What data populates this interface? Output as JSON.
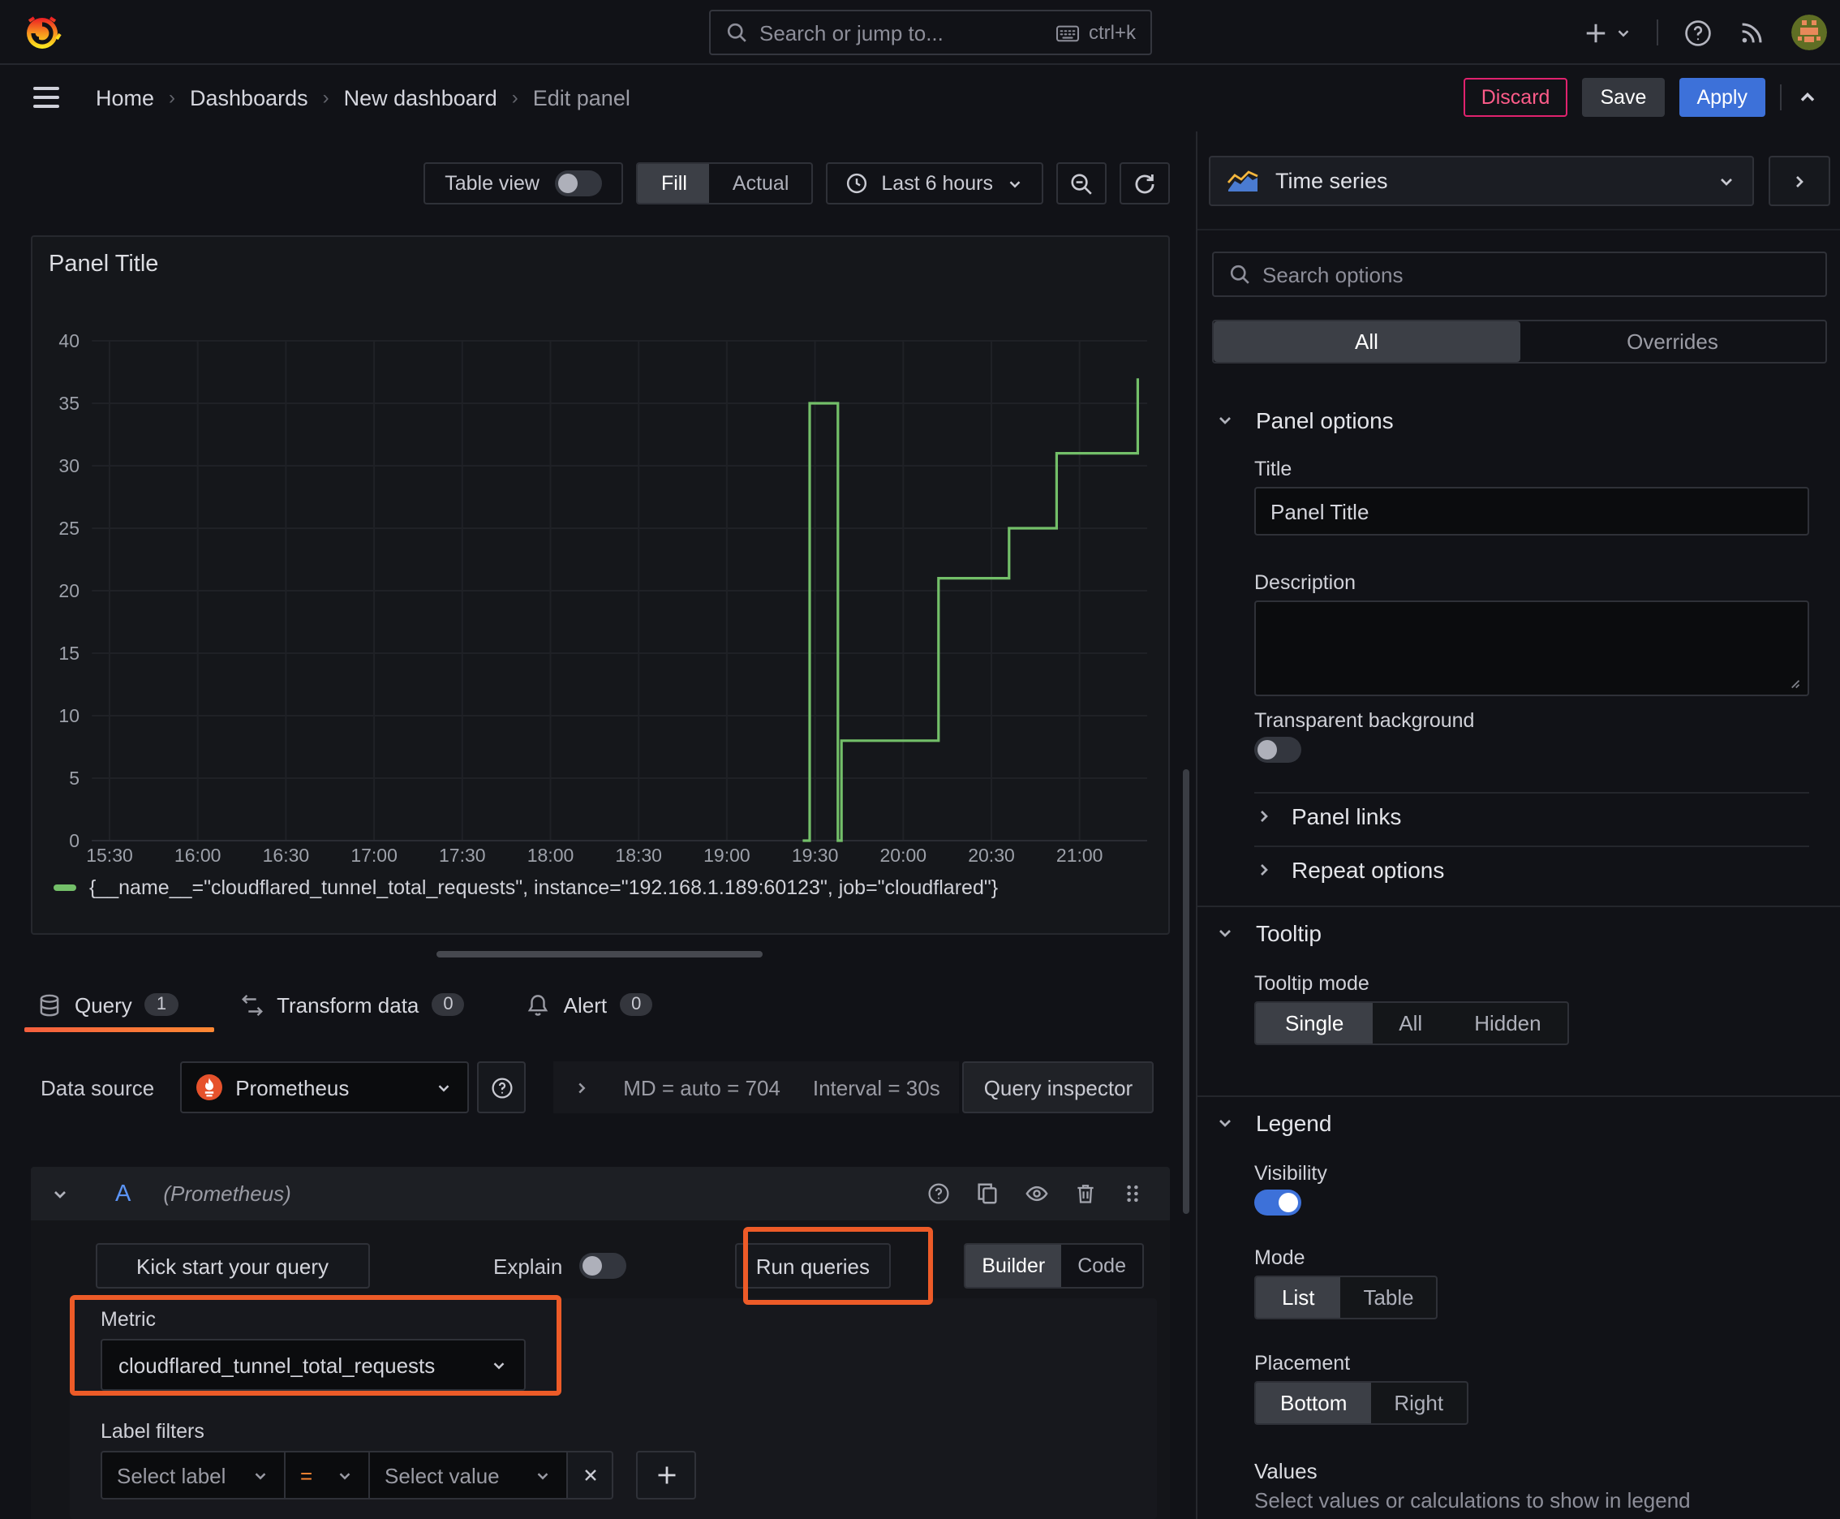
{
  "topnav": {
    "search_placeholder": "Search or jump to...",
    "search_shortcut": "ctrl+k"
  },
  "breadcrumbs": {
    "items": [
      "Home",
      "Dashboards",
      "New dashboard",
      "Edit panel"
    ]
  },
  "actions": {
    "discard": "Discard",
    "save": "Save",
    "apply": "Apply"
  },
  "toolbar": {
    "table_view": "Table view",
    "fill": "Fill",
    "actual": "Actual",
    "time_range": "Last 6 hours"
  },
  "panel": {
    "title": "Panel Title"
  },
  "chart_data": {
    "type": "line",
    "title": "Panel Title",
    "x_ticks": [
      {
        "t": 15.5,
        "label": "15:30"
      },
      {
        "t": 16,
        "label": "16:00"
      },
      {
        "t": 16.5,
        "label": "16:30"
      },
      {
        "t": 17,
        "label": "17:00"
      },
      {
        "t": 17.5,
        "label": "17:30"
      },
      {
        "t": 18,
        "label": "18:00"
      },
      {
        "t": 18.5,
        "label": "18:30"
      },
      {
        "t": 19,
        "label": "19:00"
      },
      {
        "t": 19.5,
        "label": "19:30"
      },
      {
        "t": 20,
        "label": "20:00"
      },
      {
        "t": 20.5,
        "label": "20:30"
      },
      {
        "t": 21,
        "label": "21:00"
      }
    ],
    "y_ticks": [
      0,
      5,
      10,
      15,
      20,
      25,
      30,
      35,
      40
    ],
    "ylim": [
      0,
      40
    ],
    "x_range": [
      15.4,
      21.38
    ],
    "grid": true,
    "legend_position": "bottom",
    "series": [
      {
        "name": "{__name__=\"cloudflared_tunnel_total_requests\", instance=\"192.168.1.189:60123\", job=\"cloudflared\"}",
        "color": "#73bf69",
        "points": [
          [
            19.43,
            0
          ],
          [
            19.47,
            0
          ],
          [
            19.47,
            35
          ],
          [
            19.63,
            35
          ],
          [
            19.63,
            0
          ],
          [
            19.65,
            0
          ],
          [
            19.65,
            8
          ],
          [
            20.2,
            8
          ],
          [
            20.2,
            21
          ],
          [
            20.6,
            21
          ],
          [
            20.6,
            25
          ],
          [
            20.87,
            25
          ],
          [
            20.87,
            31
          ],
          [
            21.33,
            31
          ],
          [
            21.33,
            37
          ]
        ]
      }
    ]
  },
  "tabs": {
    "query": "Query",
    "query_count": "1",
    "transform": "Transform data",
    "transform_count": "0",
    "alert": "Alert",
    "alert_count": "0"
  },
  "datasource": {
    "label": "Data source",
    "name": "Prometheus",
    "stat_md": "MD = auto = 704",
    "stat_interval": "Interval = 30s",
    "inspector": "Query inspector"
  },
  "query": {
    "ref_id": "A",
    "ds_hint": "(Prometheus)",
    "kickstart": "Kick start your query",
    "explain": "Explain",
    "run": "Run queries",
    "builder": "Builder",
    "code": "Code",
    "metric_label": "Metric",
    "metric_value": "cloudflared_tunnel_total_requests",
    "label_filters": "Label filters",
    "select_label": "Select label",
    "operator": "=",
    "select_value": "Select value"
  },
  "sidebar": {
    "viz": "Time series",
    "search_placeholder": "Search options",
    "tab_all": "All",
    "tab_overrides": "Overrides",
    "panel_options": {
      "header": "Panel options",
      "title_label": "Title",
      "title_value": "Panel Title",
      "description_label": "Description",
      "transparent": "Transparent background",
      "panel_links": "Panel links",
      "repeat_options": "Repeat options"
    },
    "tooltip": {
      "header": "Tooltip",
      "mode_label": "Tooltip mode",
      "options": [
        "Single",
        "All",
        "Hidden"
      ]
    },
    "legend": {
      "header": "Legend",
      "visibility": "Visibility",
      "mode_label": "Mode",
      "modes": [
        "List",
        "Table"
      ],
      "placement_label": "Placement",
      "placements": [
        "Bottom",
        "Right"
      ],
      "values_label": "Values",
      "values_help": "Select values or calculations to show in legend"
    }
  },
  "accent_colors": {
    "highlight": "#ed5b28",
    "apply_blue": "#3d71d9",
    "discard_pink": "#ff5c8a",
    "series_green": "#73bf69",
    "tab_underline": "#ff8833"
  }
}
